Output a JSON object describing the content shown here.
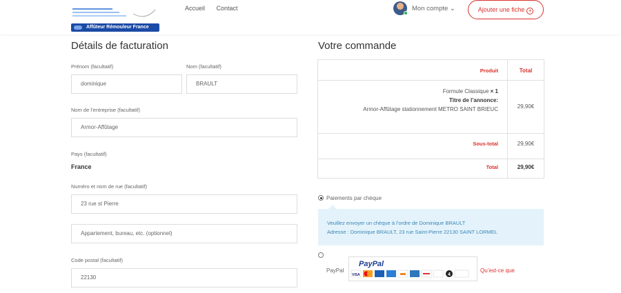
{
  "header": {
    "logo_text": "Affûteur Rémouleur France",
    "nav": [
      "Accueil",
      "Contact"
    ],
    "account_label": "Mon compte ⌄",
    "add_button": "Ajouter une fiche"
  },
  "billing": {
    "title": "Détails de facturation",
    "first_name_label": "Prénom (facultatif)",
    "first_name": "dominique",
    "last_name_label": "Nom (facultatif)",
    "last_name": "BRAULT",
    "company_label": "Nom de l’entreprise (facultatif)",
    "company": "Armor-Affûtage",
    "country_label": "Pays (facultatif)",
    "country": "France",
    "street_label": "Numéro et nom de rue (facultatif)",
    "street": "23 rue st Pierre",
    "apartment_placeholder": "Appartement, bureau, etc. (optionnel)",
    "postcode_label": "Code postal (facultatif)",
    "postcode": "22130"
  },
  "order": {
    "title": "Votre commande",
    "col_product": "Produit",
    "col_total": "Total",
    "item_name": "Formule Classique",
    "item_qty": "× 1",
    "item_meta_label": "Titre de l’annonce:",
    "item_meta_value": "Armor-Affûtage stationnement METRO SAINT BRIEUC",
    "item_total": "29,90€",
    "subtotal_label": "Sous-total",
    "subtotal": "29,90€",
    "total_label": "Total",
    "total": "29,90€"
  },
  "payment": {
    "cheque_label": "Paiements par chèque",
    "cheque_info_1": "Veuillez envoyer un chèque à l’ordre de Dominique BRAULT",
    "cheque_info_2": "Adresse : Dominique BRAULT, 23 rue Saint-Pierre 22130 SAINT LORMEL",
    "paypal_label": "PayPal",
    "paypal_brand": "PayPal",
    "paypal_link": "Qu’est-ce que"
  },
  "colors": {
    "accent": "#d9302a",
    "info_bg": "#e4f3fb",
    "info_text": "#3b86b5",
    "brand_blue": "#1a4aa6"
  }
}
